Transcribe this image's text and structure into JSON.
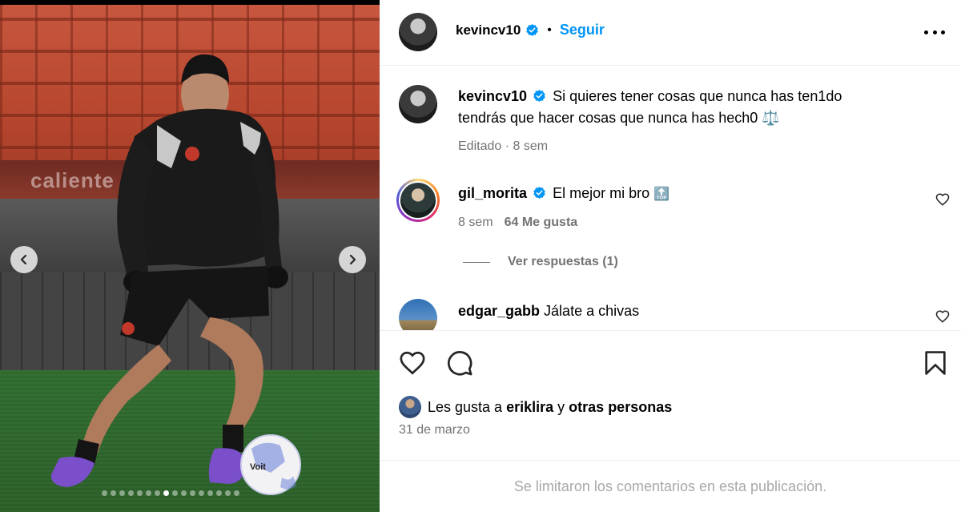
{
  "media": {
    "banner_text": "caliente  cuenta.mx",
    "slide_count": 16,
    "active_slide": 8,
    "prev_icon": "chevron-left-icon",
    "next_icon": "chevron-right-icon"
  },
  "post": {
    "author": "kevincv10",
    "follow_label": "Seguir",
    "separator": "•",
    "caption_line1": "Si quieres tener cosas que nunca has ten1do",
    "caption_line2": "tendrás que hacer cosas que nunca has hech0 ⚖️",
    "caption_meta": "Editado · 8 sem"
  },
  "comments": [
    {
      "user": "gil_morita",
      "verified": true,
      "text": "El mejor mi bro",
      "emoji": "🔝",
      "time": "8 sem",
      "likes": "64 Me gusta",
      "replies_label": "Ver respuestas (1)"
    },
    {
      "user": "edgar_gabb",
      "verified": false,
      "text": "Jálate a chivas"
    }
  ],
  "likes": {
    "prefix": "Les gusta a",
    "user": "eriklira",
    "connector": "y",
    "others": "otras personas"
  },
  "date": "31 de marzo",
  "comments_limited": "Se limitaron los comentarios en esta publicación.",
  "colors": {
    "accent": "#0095f6",
    "secondary_text": "#737373",
    "divider": "#efefef"
  }
}
